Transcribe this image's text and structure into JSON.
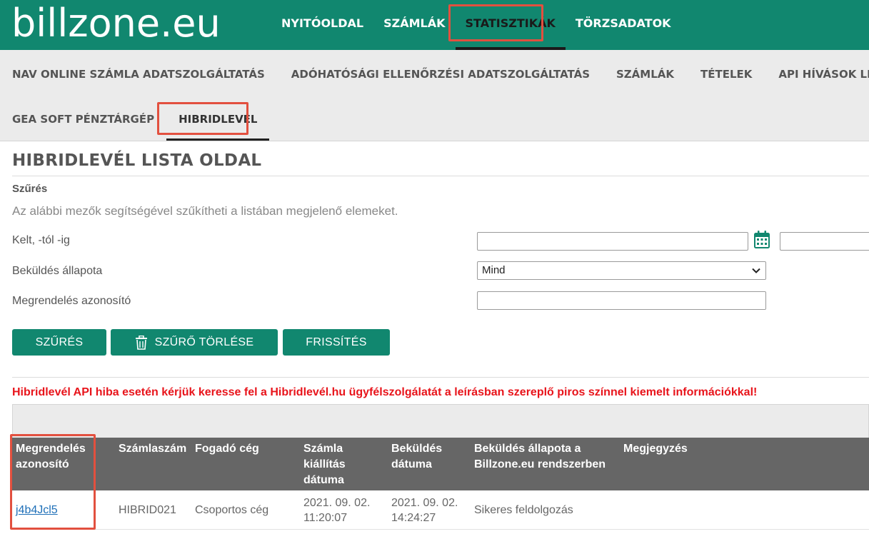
{
  "logo": "billzone.eu",
  "topnav": [
    "NYITÓOLDAL",
    "SZÁMLÁK",
    "STATISZTIKÁK",
    "TÖRZSADATOK"
  ],
  "subnav_row1": [
    "NAV ONLINE SZÁMLA ADATSZOLGÁLTATÁS",
    "ADÓHATÓSÁGI ELLENŐRZÉSI ADATSZOLGÁLTATÁS",
    "SZÁMLÁK",
    "TÉTELEK",
    "API HÍVÁSOK LISTÁJA"
  ],
  "subnav_row2": [
    "GEA SOFT PÉNZTÁRGÉP",
    "HIBRIDLEVÉL"
  ],
  "page_title": "HIBRIDLEVÉL LISTA OLDAL",
  "filter": {
    "heading": "Szűrés",
    "description": "Az alábbi mezők segítségével szűkítheti a listában megjelenő elemeket.",
    "date_label": "Kelt, -tól -ig",
    "status_label": "Beküldés állapota",
    "status_value": "Mind",
    "order_label": "Megrendelés azonosító"
  },
  "buttons": {
    "filter": "SZŰRÉS",
    "clear": "SZŰRŐ TÖRLÉSE",
    "refresh": "FRISSÍTÉS"
  },
  "warning": "Hibridlevél API hiba esetén kérjük keresse fel a Hibridlevél.hu ügyfélszolgálatát a leírásban szereplő piros színnel kiemelt információkkal!",
  "table": {
    "headers": {
      "order_1": "Megrendelés",
      "order_2": "azonosító",
      "invoice": "Számlaszám",
      "recipient": "Fogadó cég",
      "date_1": "Számla",
      "date_2": "kiállítás",
      "date_3": "dátuma",
      "sent_1": "Beküldés",
      "sent_2": "dátuma",
      "status_1": "Beküldés állapota a",
      "status_2": "Billzone.eu rendszerben",
      "note": "Megjegyzés"
    },
    "rows": [
      {
        "order": "j4b4Jcl5",
        "invoice": "HIBRID021",
        "recipient": "Csoportos cég",
        "issue_date": "2021. 09. 02.",
        "issue_time": "11:20:07",
        "sent_date": "2021. 09. 02.",
        "sent_time": "14:24:27",
        "status": "Sikeres feldolgozás",
        "note": ""
      }
    ]
  },
  "colors": {
    "brand": "#11876f",
    "highlight": "#e2503f",
    "warning": "#e8141b",
    "table_header": "#666666"
  }
}
